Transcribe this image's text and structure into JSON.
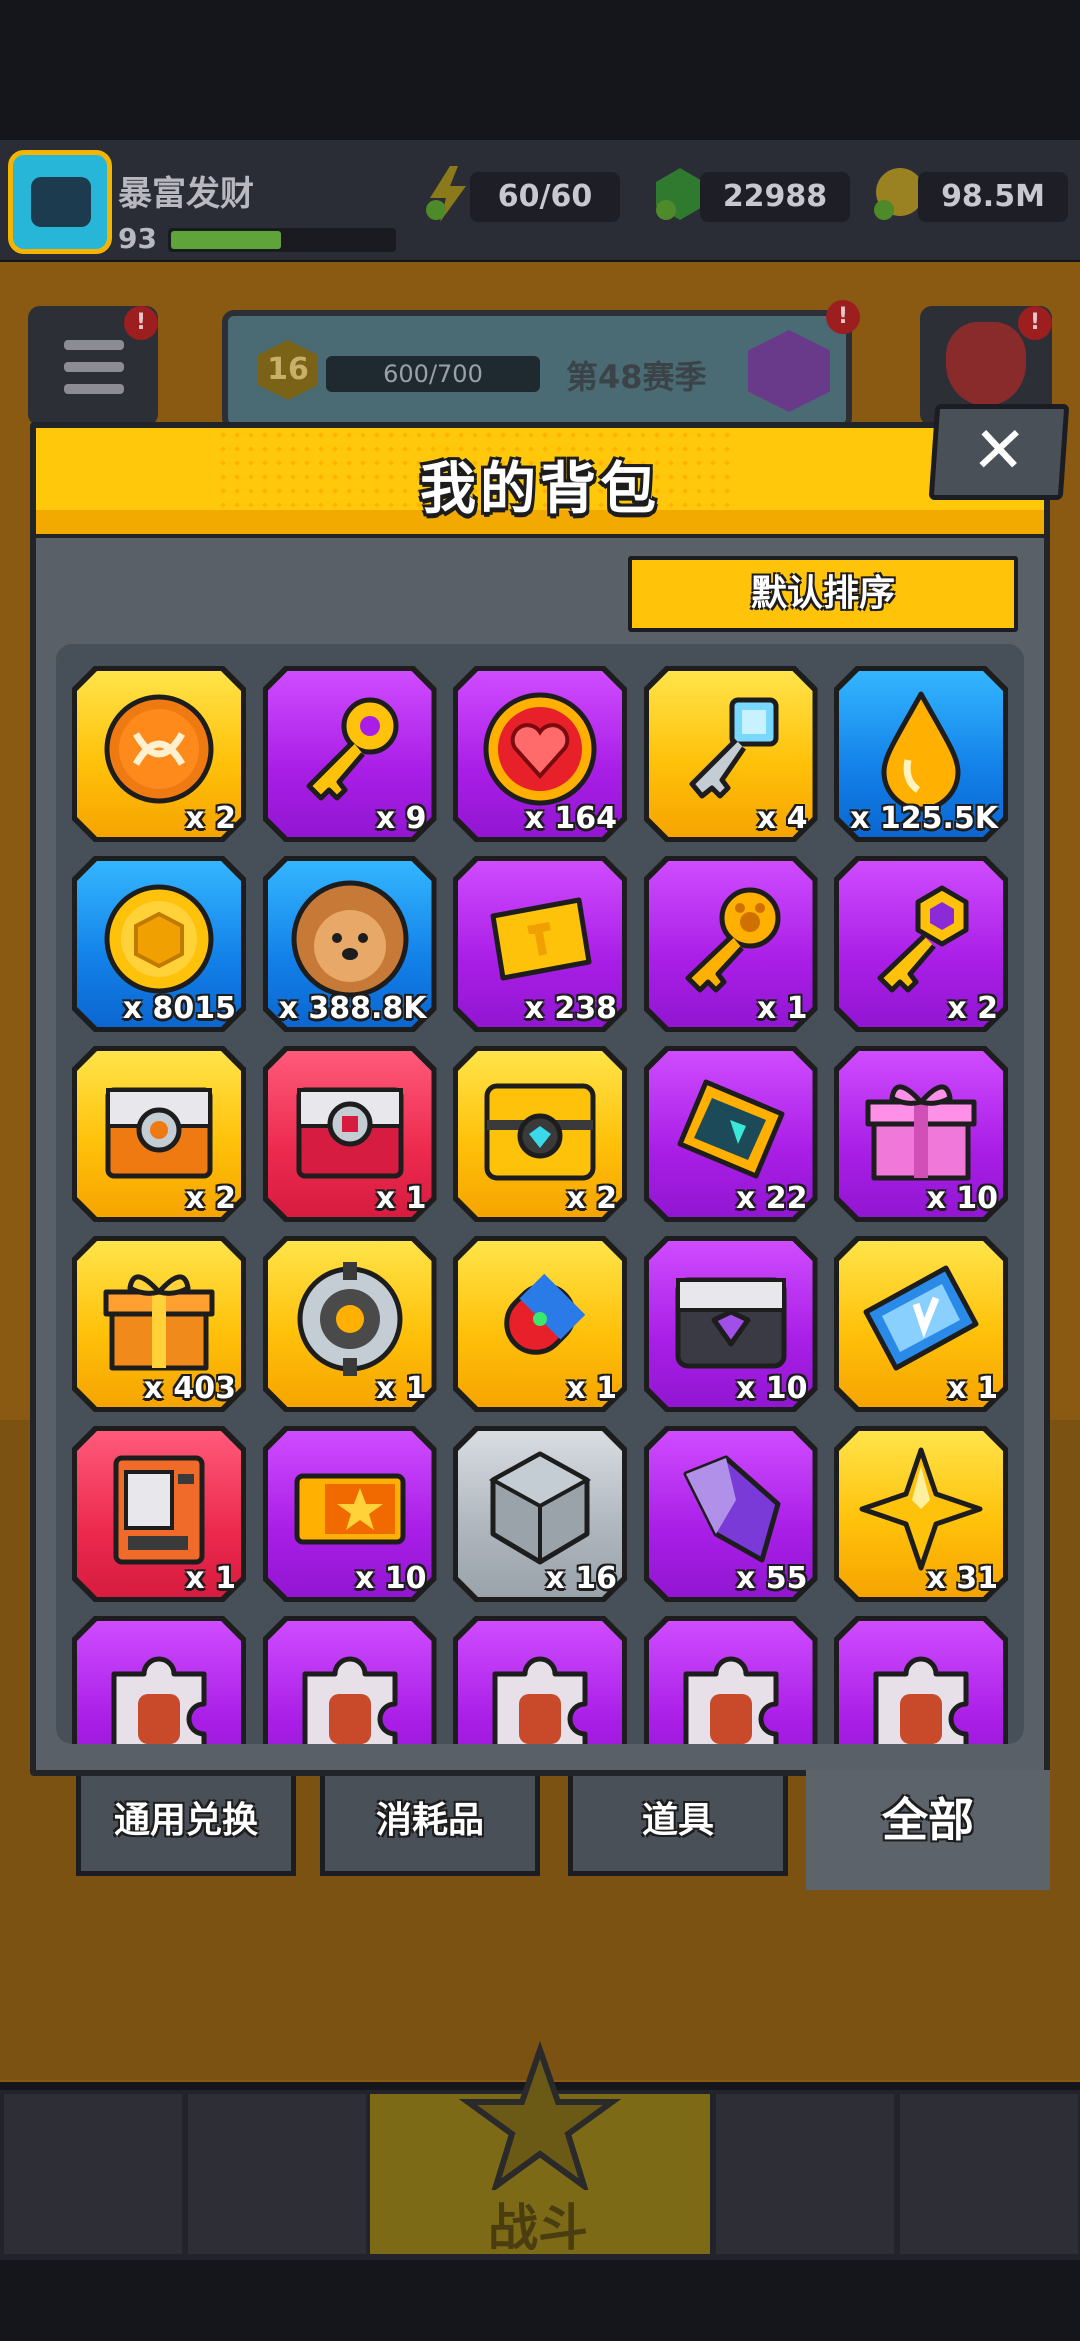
{
  "player": {
    "name": "暴富发财",
    "level": "93",
    "avatar_color": "#27b6d8"
  },
  "resources": [
    {
      "icon": "lightning-plus-icon",
      "value": "60/60",
      "color": "#c9b020"
    },
    {
      "icon": "gem-plus-icon",
      "value": "22988",
      "color": "#3a8a3a"
    },
    {
      "icon": "coin-plus-icon",
      "value": "98.5M",
      "color": "#c9a020"
    }
  ],
  "season": {
    "level": "16",
    "progress": "600/700",
    "label": "第48赛季",
    "progress_fraction": 0.857
  },
  "background_labels": {
    "bottom_center": "战斗"
  },
  "modal": {
    "title": "我的背包",
    "close_label": "✕",
    "sort_label": "默认排序",
    "items": [
      {
        "icon": "orange-coin-icon",
        "rarity": "gold",
        "count": "x 2"
      },
      {
        "icon": "gold-key-icon",
        "rarity": "purple",
        "count": "x 9"
      },
      {
        "icon": "heart-coin-icon",
        "rarity": "purple",
        "count": "x 164"
      },
      {
        "icon": "silver-key-icon",
        "rarity": "gold",
        "count": "x 4"
      },
      {
        "icon": "oil-drop-icon",
        "rarity": "blue",
        "count": "x 125.5K"
      },
      {
        "icon": "gold-token-icon",
        "rarity": "blue",
        "count": "x 8015"
      },
      {
        "icon": "dog-cookie-icon",
        "rarity": "blue",
        "count": "x 388.8K"
      },
      {
        "icon": "gold-ticket-icon",
        "rarity": "purple",
        "count": "x 238"
      },
      {
        "icon": "paw-key-icon",
        "rarity": "purple",
        "count": "x 1"
      },
      {
        "icon": "gem-key-icon",
        "rarity": "purple",
        "count": "x 2"
      },
      {
        "icon": "orange-chest-icon",
        "rarity": "gold",
        "count": "x 2"
      },
      {
        "icon": "red-chest-icon",
        "rarity": "red",
        "count": "x 1"
      },
      {
        "icon": "gold-chest-icon",
        "rarity": "gold",
        "count": "x 2"
      },
      {
        "icon": "diamond-card-icon",
        "rarity": "purple",
        "count": "x 22"
      },
      {
        "icon": "pink-gift-icon",
        "rarity": "purple",
        "count": "x 10"
      },
      {
        "icon": "orange-gift-icon",
        "rarity": "gold",
        "count": "x 403"
      },
      {
        "icon": "gear-part-icon",
        "rarity": "gold",
        "count": "x 1"
      },
      {
        "icon": "capsule-icon",
        "rarity": "gold",
        "count": "x 1"
      },
      {
        "icon": "dark-chest-icon",
        "rarity": "purple",
        "count": "x 10"
      },
      {
        "icon": "vip-ticket-icon",
        "rarity": "gold",
        "count": "x 1"
      },
      {
        "icon": "vending-machine-icon",
        "rarity": "red",
        "count": "x 1"
      },
      {
        "icon": "star-ticket-icon",
        "rarity": "purple",
        "count": "x 10"
      },
      {
        "icon": "cube-icon",
        "rarity": "gray",
        "count": "x 16"
      },
      {
        "icon": "crystal-shard-icon",
        "rarity": "purple",
        "count": "x 55"
      },
      {
        "icon": "gold-star-icon",
        "rarity": "gold",
        "count": "x 31"
      },
      {
        "icon": "puzzle-piece-icon",
        "rarity": "purple",
        "count": ""
      },
      {
        "icon": "puzzle-piece-icon",
        "rarity": "purple",
        "count": ""
      },
      {
        "icon": "puzzle-piece-icon",
        "rarity": "purple",
        "count": ""
      },
      {
        "icon": "puzzle-piece-icon",
        "rarity": "purple",
        "count": ""
      },
      {
        "icon": "puzzle-piece-icon",
        "rarity": "purple",
        "count": ""
      }
    ],
    "tabs": [
      {
        "label": "通用兑换",
        "active": false
      },
      {
        "label": "消耗品",
        "active": false
      },
      {
        "label": "道具",
        "active": false
      },
      {
        "label": "全部",
        "active": true
      }
    ]
  },
  "colors": {
    "gold": "#ffc10a",
    "purple": "#a91ee6",
    "blue": "#1280e8",
    "red": "#ec2a4e",
    "gray": "#aeb5bc"
  }
}
